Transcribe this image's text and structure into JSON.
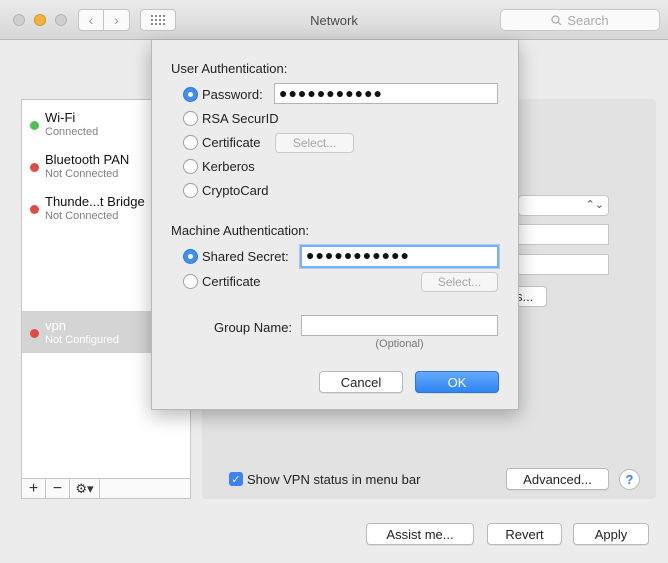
{
  "window": {
    "title": "Network"
  },
  "search": {
    "placeholder": "Search"
  },
  "services": [
    {
      "name": "Wi-Fi",
      "status": "Connected",
      "color": "#4cc15a"
    },
    {
      "name": "Bluetooth PAN",
      "status": "Not Connected",
      "color": "#e24a45"
    },
    {
      "name": "Thunde...t Bridge",
      "status": "Not Connected",
      "color": "#e24a45"
    },
    {
      "name": "vpn",
      "status": "Not Configured",
      "color": "#e24a45"
    }
  ],
  "sidebar_tools": {
    "add": "+",
    "remove": "−",
    "gear": "⚙▾"
  },
  "dialog": {
    "user_auth_heading": "User Authentication:",
    "password_label": "Password:",
    "password_value": "●●●●●●●●●●●",
    "rsa_label": "RSA SecurID",
    "certificate_label": "Certificate",
    "select_label": "Select...",
    "kerberos_label": "Kerberos",
    "cryptocard_label": "CryptoCard",
    "machine_auth_heading": "Machine Authentication:",
    "shared_secret_label": "Shared Secret:",
    "shared_secret_value": "●●●●●●●●●●●",
    "machine_certificate_label": "Certificate",
    "machine_select_label": "Select...",
    "group_name_label": "Group Name:",
    "group_name_value": "",
    "optional_hint": "(Optional)",
    "cancel_label": "Cancel",
    "ok_label": "OK"
  },
  "panel": {
    "partial_button": "s...",
    "show_vpn_status_label": "Show VPN status in menu bar",
    "show_vpn_status_checked": true,
    "advanced_label": "Advanced...",
    "help_label": "?"
  },
  "footer": {
    "assist_label": "Assist me...",
    "revert_label": "Revert",
    "apply_label": "Apply"
  },
  "colors": {
    "accent": "#3f8ff7",
    "focus_ring": "#7ab0f4"
  }
}
